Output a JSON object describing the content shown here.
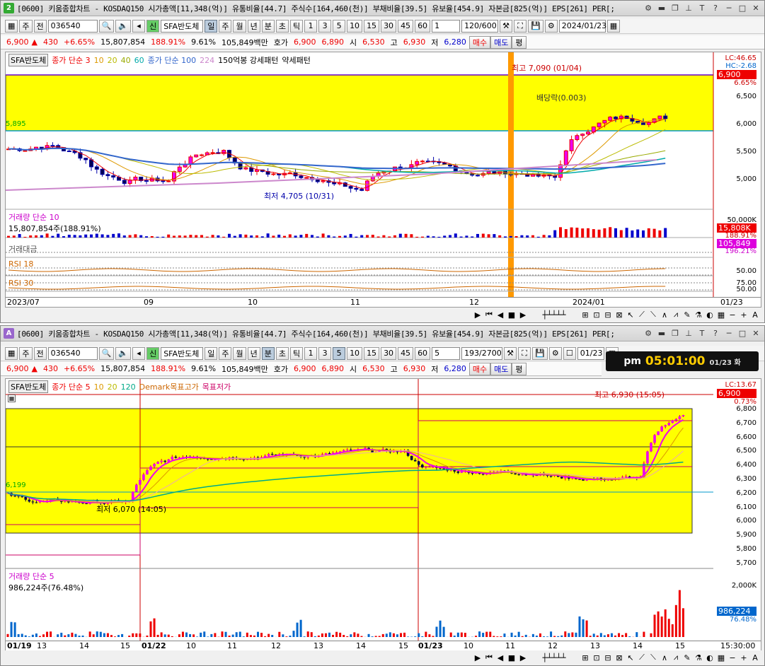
{
  "top": {
    "num": "2",
    "title": "[0600] 키움종합차트 - KOSDAQ150 시가총액[11,348(억)] 유통비율[44.7] 주식수[164,460(천)] 부채비율[39.5] 유보율[454.9] 자본금[825(억)] EPS[261] PER[;",
    "tb": {
      "ju": "주",
      "jeon": "전",
      "code": "036540",
      "name": "SFA반도체",
      "il": "일",
      "wk": "주",
      "mo": "월",
      "yr": "년",
      "bun": "분",
      "cho": "초",
      "tick": "틱",
      "n1": "1",
      "n3": "3",
      "n5": "5",
      "n10": "10",
      "n15": "15",
      "n30": "30",
      "n45": "45",
      "n60": "60",
      "sel": "1",
      "count": "120/600",
      "date": "2024/01/23"
    },
    "q": {
      "price": "6,900",
      "chg": "430",
      "pct": "+6.65%",
      "vol": "15,807,854",
      "volpct": "188.91%",
      "turn": "9.61%",
      "amt": "105,849백만",
      "hoga": "호가",
      "hoga1": "6,900",
      "hoga2": "6,890",
      "si": "시",
      "open": "6,530",
      "go": "고",
      "high": "6,930",
      "jeo": "저",
      "low": "6,280",
      "buy": "매수",
      "sell": "매도",
      "pyeong": "평"
    },
    "legend": {
      "tag": "SFA반도체",
      "a": "종가 단순 3",
      "m1": "10",
      "m2": "20",
      "m3": "40",
      "m4": "60",
      "b": "종가 단순 100",
      "m5": "224",
      "c": "150억봉 강세패턴",
      "d": "약세패턴"
    },
    "ann": {
      "high": "최고 7,090 (01/04)",
      "low": "최저 4,705 (10/31)",
      "div": "배당락(0.003)",
      "left": "5,895"
    },
    "prices": {
      "lc": "LC:46.65",
      "hc": "HC:-2.68",
      "cur": "6,900",
      "pct": "6.65%",
      "p1": "6,500",
      "p2": "6,000",
      "p3": "5,500",
      "p4": "5,000"
    },
    "vol": {
      "lbl": "거래량",
      "lbl2": "단순 10",
      "val": "15,807,854주(188.91%)",
      "p1": "50,000K",
      "cur": "15,808K",
      "pct": "188.91%"
    },
    "amt": {
      "lbl": "거래대금",
      "cur": "105,849",
      "pct": "196.21%"
    },
    "rsi1": {
      "lbl": "RSI 18",
      "p": "50.00"
    },
    "rsi2": {
      "lbl": "RSI 30",
      "p1": "75.00",
      "p2": "50.00"
    },
    "x": [
      "2023/07",
      "09",
      "10",
      "11",
      "12",
      "2024/01",
      "01/23"
    ]
  },
  "bot": {
    "num": "A",
    "title": "[0600] 키움종합차트 - KOSDAQ150 시가총액[11,348(억)] 유통비율[44.7] 주식수[164,460(천)] 부채비율[39.5] 유보율[454.9] 자본금[825(억)] EPS[261] PER[;",
    "tb": {
      "ju": "주",
      "jeon": "전",
      "code": "036540",
      "name": "SFA반도체",
      "il": "일",
      "wk": "주",
      "mo": "월",
      "yr": "년",
      "bun": "분",
      "cho": "초",
      "tick": "틱",
      "n1": "1",
      "n3": "3",
      "n5": "5",
      "n10": "10",
      "n15": "15",
      "n30": "30",
      "n45": "45",
      "n60": "60",
      "sel": "5",
      "count": "193/2700",
      "date": "01/23"
    },
    "q": {
      "price": "6,900",
      "chg": "430",
      "pct": "+6.65%",
      "vol": "15,807,854",
      "volpct": "188.91%",
      "turn": "9.61%",
      "amt": "105,849백만",
      "hoga": "호가",
      "hoga1": "6,900",
      "hoga2": "6,890",
      "si": "시",
      "open": "6,530",
      "go": "고",
      "high": "6,930",
      "jeo": "저",
      "low": "6,280",
      "buy": "매수",
      "sell": "매도",
      "pyeong": "평"
    },
    "clock": {
      "ampm": "pm",
      "time": "05:01:00",
      "date": "01/23 화"
    },
    "legend": {
      "tag": "SFA반도체",
      "a": "종가 단순 5",
      "m1": "10",
      "m2": "20",
      "m3": "120",
      "b": "Demark목표고가",
      "c": "목표저가"
    },
    "ann": {
      "high": "최고 6,930 (15:05)",
      "low": "최저 6,070 (14:05)",
      "left": "6,199"
    },
    "prices": {
      "lc": "LC:13.67",
      "cur": "6,900",
      "pct": "0.73%",
      "p": [
        "6,800",
        "6,700",
        "6,600",
        "6,500",
        "6,400",
        "6,300",
        "6,200",
        "6,100",
        "6,000",
        "5,900",
        "5,800",
        "5,700"
      ]
    },
    "vol": {
      "lbl": "거래량",
      "lbl2": "단순 5",
      "val": "986,224주(76.48%)",
      "p1": "2,000K",
      "p2": "1,000K",
      "cur": "986,224",
      "pct": "76.48%"
    },
    "x": [
      "01/19",
      "13",
      "14",
      "15",
      "01/22",
      "10",
      "11",
      "12",
      "13",
      "14",
      "15",
      "01/23",
      "10",
      "11",
      "12",
      "13",
      "14",
      "15",
      "15:30:00"
    ]
  }
}
